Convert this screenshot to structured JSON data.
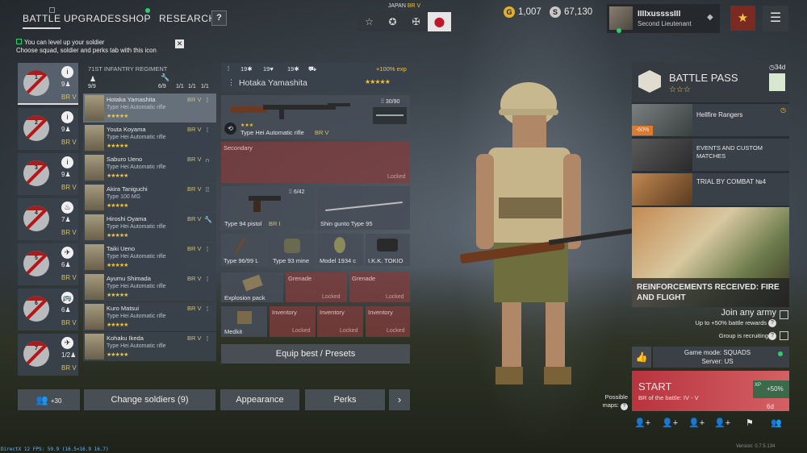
{
  "nav": {
    "tabs": [
      "BATTLE",
      "UPGRADES",
      "SHOP",
      "RESEARCH"
    ],
    "help": "?"
  },
  "nation": {
    "name": "JAPAN",
    "br": "BR V"
  },
  "mode_icons": [
    "star-outline-icon",
    "star-circle-icon",
    "cross-icon",
    "hinomaru-icon"
  ],
  "currency": {
    "gold": "1,007",
    "silver": "67,130"
  },
  "profile": {
    "name": "IIIIxussssIII",
    "rank": "Second Lieutenant"
  },
  "notification": {
    "line1": "You can level up your soldier",
    "line2": "Choose squad, soldier and perks tab with this icon"
  },
  "squads": [
    {
      "num": "1",
      "count": "9",
      "br": "BR V",
      "class": "i"
    },
    {
      "num": "2",
      "count": "9",
      "br": "BR V",
      "class": "i"
    },
    {
      "num": "3",
      "count": "9",
      "br": "BR V",
      "class": "i"
    },
    {
      "num": "4",
      "count": "7",
      "br": "BR V",
      "class": "♨"
    },
    {
      "num": "5",
      "count": "6",
      "br": "BR V",
      "class": "✈"
    },
    {
      "num": "6",
      "count": "6",
      "br": "BR V",
      "class": "🚌"
    },
    {
      "num": "7",
      "count": "1/2",
      "br": "BR V",
      "class": "✈"
    }
  ],
  "squad_header": {
    "title": "71ST INFANTRY REGIMENT",
    "count": "9/9",
    "slots": [
      "6/9",
      "1/1",
      "1/1",
      "1/1"
    ]
  },
  "soldiers": [
    {
      "name": "Hotaka Yamashita",
      "weapon": "Type Hei Automatic rifle",
      "br": "BR V"
    },
    {
      "name": "Youta Koyama",
      "weapon": "Type Hei Automatic rifle",
      "br": "BR V"
    },
    {
      "name": "Saburo Ueno",
      "weapon": "Type Hei Automatic rifle",
      "br": "BR V"
    },
    {
      "name": "Akira Taniguchi",
      "weapon": "Type 100 MG",
      "br": "BR V"
    },
    {
      "name": "Hiroshi Oyama",
      "weapon": "Type Hei Automatic rifle",
      "br": "BR V"
    },
    {
      "name": "Taiki Ueno",
      "weapon": "Type Hei Automatic rifle",
      "br": "BR V"
    },
    {
      "name": "Ayumu Shimada",
      "weapon": "Type Hei Automatic rifle",
      "br": "BR V"
    },
    {
      "name": "Kuro Matsui",
      "weapon": "Type Hei Automatic rifle",
      "br": "BR V"
    },
    {
      "name": "Kohaku Ikeda",
      "weapon": "Type Hei Automatic rifle",
      "br": "BR V"
    }
  ],
  "soldier_stars": "★★★★★",
  "loadout": {
    "stats": [
      "19",
      "19",
      "19"
    ],
    "exp": "+100% exp",
    "name": "Hotaka Yamashita",
    "primary": {
      "name": "Type Hei Automatic rifle",
      "br": "BR V",
      "ammo": "30/90",
      "stars": "★★★"
    },
    "secondary": {
      "label": "Secondary",
      "locked": "Locked"
    },
    "pistol": {
      "name": "Type 94 pistol",
      "br": "BR I",
      "ammo": "6/42"
    },
    "melee": {
      "name": "Shin gunto Type 95"
    },
    "items": [
      "Type 96/99 L",
      "Type 93 mine",
      "Model 1934 c",
      "I.K.K. TOKIO"
    ],
    "explosion": "Explosion pack",
    "grenade": "Grenade",
    "inventory": "Inventory",
    "medkit": "Medkit",
    "locked": "Locked",
    "equip_best": "Equip best / Presets"
  },
  "bottom": {
    "reserve": "+30",
    "change_soldiers": "Change soldiers (9)",
    "appearance": "Appearance",
    "perks": "Perks",
    "more": "›"
  },
  "battle_pass": {
    "title": "BATTLE PASS",
    "days": "34d",
    "events": [
      {
        "title": "Hellfire Rangers",
        "discount": "-60%"
      },
      {
        "title": "EVENTS AND CUSTOM MATCHES"
      },
      {
        "title": "TRIAL BY COMBAT №4"
      }
    ],
    "banner": "REINFORCEMENTS RECEIVED: FIRE AND FLIGHT"
  },
  "join": {
    "label": "Join any army",
    "bonus": "Up to +50% battle rewards",
    "group": "Group is recruiting"
  },
  "game_mode": {
    "mode": "Game mode: SQUADS",
    "server": "Server: US"
  },
  "start": {
    "label": "START",
    "br": "BR of the battle: IV - V",
    "boost": "+50% 6d",
    "xp": "XP"
  },
  "possible_maps": {
    "line1": "Possible",
    "line2": "maps:"
  },
  "debug": "DirectX 12 FPS: 59.9 (16.5<16.9 16.7)",
  "version": "Version: 0.7.5.134"
}
